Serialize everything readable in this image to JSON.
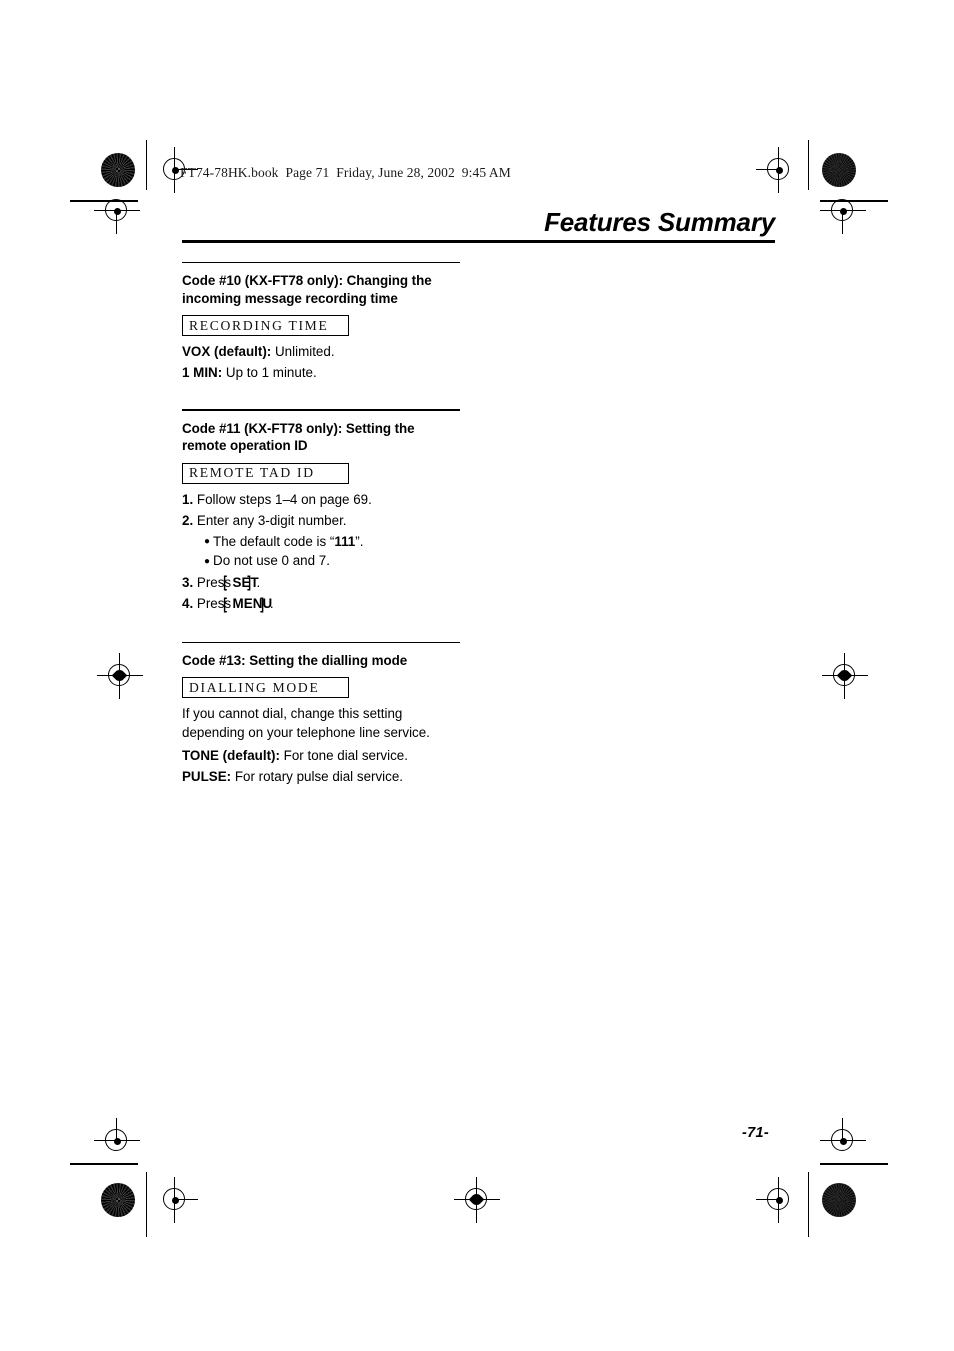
{
  "header": {
    "file_info": "FT74-78HK.book  Page 71  Friday, June 28, 2002  9:45 AM"
  },
  "running_head": {
    "title": "Features Summary"
  },
  "folio": {
    "page_number": "-71-"
  },
  "sections": [
    {
      "heading": "Code #10 (KX-FT78 only): Changing the incoming message recording time",
      "lcd_display": "RECORDING TIME",
      "lines": [
        {
          "label": "VOX (default):",
          "text": " Unlimited."
        },
        {
          "label": "1 MIN:",
          "text": " Up to 1 minute."
        }
      ]
    },
    {
      "heading": "Code #11 (KX-FT78 only): Setting the remote operation ID",
      "lcd_display": "REMOTE TAD ID",
      "steps": [
        {
          "num": "1.",
          "text": " Follow steps 1–4 on page 69."
        },
        {
          "num": "2.",
          "text": " Enter any 3-digit number."
        }
      ],
      "bullets": [
        {
          "pre": "The default code is “",
          "strong": "111",
          "post": "”."
        },
        {
          "pre": "Do not use 0 and 7.",
          "strong": "",
          "post": ""
        }
      ],
      "key_steps": [
        {
          "num": "3.",
          "press": " Press ",
          "key": "SET",
          "end": "."
        },
        {
          "num": "4.",
          "press": " Press ",
          "key": "MENU",
          "end": "."
        }
      ]
    },
    {
      "heading": "Code #13: Setting the dialling mode",
      "lcd_display": "DIALLING MODE",
      "paragraph": "If you cannot dial, change this setting depending on your telephone line service.",
      "lines": [
        {
          "label": "TONE (default):",
          "text": " For tone dial service."
        },
        {
          "label": "PULSE:",
          "text": " For rotary pulse dial service."
        }
      ]
    }
  ],
  "print_marks": {
    "bullet_glyph": "●",
    "bracket_open": "[",
    "bracket_close": "]"
  }
}
